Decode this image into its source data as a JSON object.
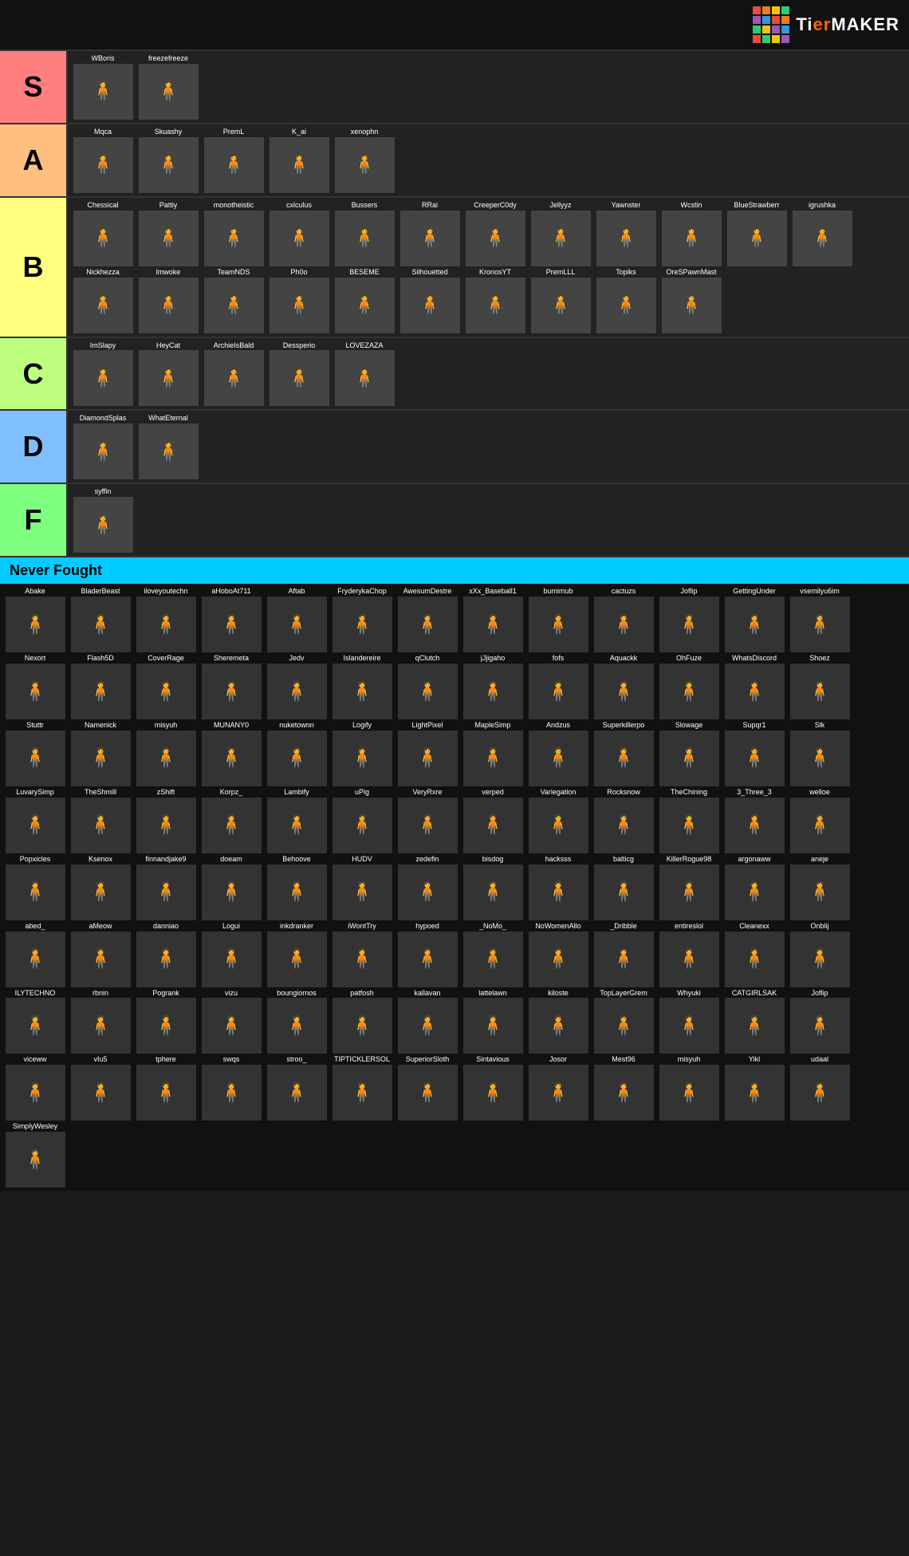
{
  "logo": {
    "text_ti": "Ti",
    "text_er": "er",
    "text_maker": "MAKER",
    "colors": [
      "#e74c3c",
      "#e67e22",
      "#f1c40f",
      "#2ecc71",
      "#3498db",
      "#9b59b6",
      "#e74c3c",
      "#e67e22",
      "#f1c40f",
      "#2ecc71",
      "#3498db",
      "#9b59b6",
      "#e74c3c",
      "#e67e22",
      "#f1c40f",
      "#2ecc71"
    ]
  },
  "tiers": [
    {
      "id": "S",
      "label": "S",
      "color": "#FF7F7F",
      "items": [
        "WBoris",
        "freezefreeze"
      ]
    },
    {
      "id": "A",
      "label": "A",
      "color": "#FFBF7F",
      "items": [
        "Mqca",
        "Skuashy",
        "PremL",
        "K_ai",
        "xenophn"
      ]
    },
    {
      "id": "B",
      "label": "B",
      "color": "#FFFF7F",
      "items": [
        "Chessical",
        "Pattiy",
        "monotheistic",
        "cxlculus",
        "Bussers",
        "RRai",
        "CreeperC0dy",
        "Jellyyz",
        "Yawnster",
        "Wcstin",
        "BlueStrawberr",
        "igrushka",
        "Nickhezza",
        "lmwoke",
        "TeamNDS",
        "Ph0o",
        "BESEME",
        "Silhouetted",
        "KronosYT",
        "PremLLL",
        "Topiks",
        "OreSPawnMast"
      ]
    },
    {
      "id": "C",
      "label": "C",
      "color": "#BFFF7F",
      "items": [
        "ImSlapy",
        "HeyCat",
        "ArchieIsBald",
        "Dessperio",
        "LOVEZAZA"
      ]
    },
    {
      "id": "D",
      "label": "D",
      "color": "#7FBFFF",
      "items": [
        "DiamondSplas",
        "WhatEternal"
      ]
    },
    {
      "id": "F",
      "label": "F",
      "color": "#7FFF7F",
      "items": [
        "syffin"
      ]
    }
  ],
  "never_fought": {
    "label": "Never Fought",
    "items": [
      "Abake",
      "BladerBeast",
      "iloveyoutechn",
      "aHoboAt711",
      "Aftab",
      "FryderykaChop",
      "AwesumDestre",
      "xXx_Baseball1",
      "bumimub",
      "cactuzs",
      "Joflip",
      "GettingUnder",
      "vsemilyu6im",
      "Nexort",
      "Flash5D",
      "CoverRage",
      "Sheremeta",
      "Jedv",
      "Islandereire",
      "qClutch",
      "jJjigaho",
      "fofs",
      "Aquackk",
      "OhFuze",
      "WhatsDiscord",
      "Shoez",
      "Stuttr",
      "Namenick",
      "misyuh",
      "MUNANY0",
      "nuketownn",
      "Logify",
      "LightPixel",
      "MapleSimp",
      "Andzus",
      "Superkillerpo",
      "Slowage",
      "Supqr1",
      "Slk",
      "LuvarySimp",
      "TheShmill",
      "zShift",
      "Korpz_",
      "Lambify",
      "uPig",
      "VeryRxre",
      "verped",
      "Variegation",
      "Rocksnow",
      "TheChining",
      "3_Three_3",
      "welloe",
      "Popxicles",
      "Ksenox",
      "finnandjake9",
      "doeam",
      "Behoove",
      "HUDV",
      "zedefin",
      "bisdog",
      "hacksss",
      "balticg",
      "KillerRogue98",
      "argonaww",
      "aneje",
      "abed_",
      "aMeow",
      "danniao",
      "Logui",
      "inkdranker",
      "iWontTry",
      "hypoed",
      "_NoMo_",
      "NoWomenAllo",
      "_Dribble",
      "entireslol",
      "Cleanexx",
      "Onblij",
      "ILYTECHNO",
      "rbnin",
      "Pogrank",
      "vizu",
      "boungiornos",
      "patfosh",
      "kallavan",
      "lattelawn",
      "kiloste",
      "TopLayerGrem",
      "Whyuki",
      "CATGIRLSAK",
      "Joflip",
      "viceww",
      "vIu5",
      "tphere",
      "swqs",
      "stroo_",
      "TIPTICKLERSOL",
      "SuperiorSloth",
      "Sintavious",
      "Josor",
      "Mest96",
      "misyuh",
      "Yikl",
      "udaal",
      "SimplyWesley"
    ]
  }
}
